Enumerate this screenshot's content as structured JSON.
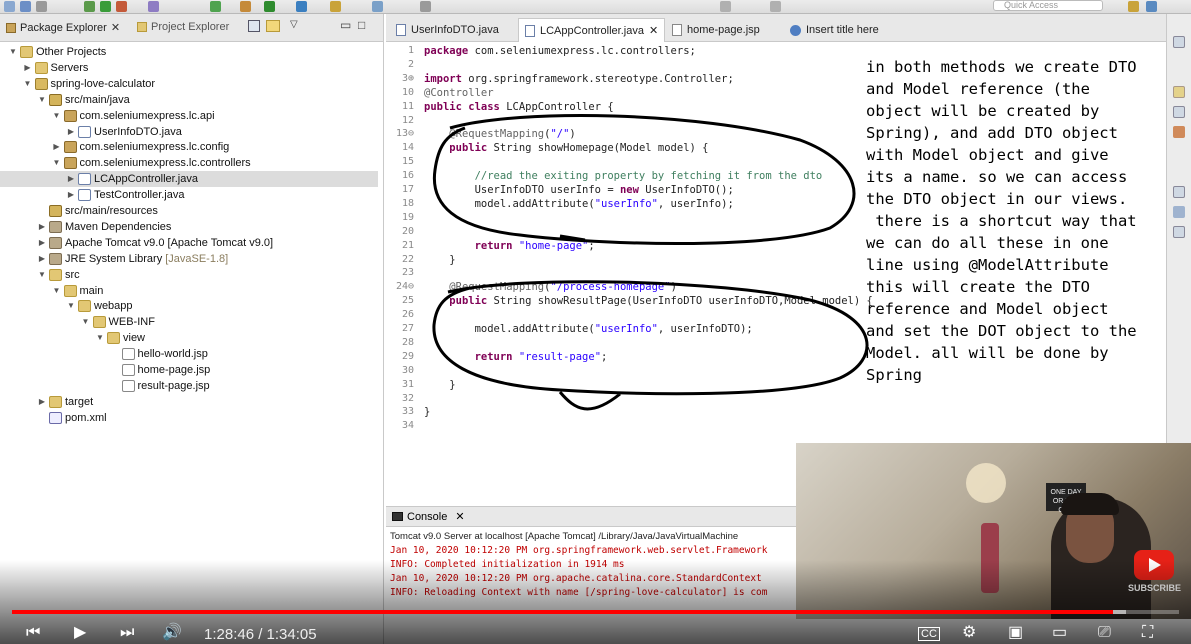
{
  "toolbar": {
    "quick_access_placeholder": "Quick Access"
  },
  "left_panel": {
    "tabs": [
      {
        "label": "Package Explorer"
      },
      {
        "label": "Project Explorer"
      }
    ],
    "tree": [
      {
        "label": "Other Projects",
        "depth": 0,
        "icon": "folder-icon",
        "expanded": true
      },
      {
        "label": "Servers",
        "depth": 1,
        "icon": "folder-icon",
        "expanded": false
      },
      {
        "label": "spring-love-calculator",
        "depth": 1,
        "icon": "project-icon",
        "expanded": true
      },
      {
        "label": "src/main/java",
        "depth": 2,
        "icon": "source-folder-icon",
        "expanded": true
      },
      {
        "label": "com.seleniumexpress.lc.api",
        "depth": 3,
        "icon": "package-icon",
        "expanded": true
      },
      {
        "label": "UserInfoDTO.java",
        "depth": 4,
        "icon": "java-file-icon",
        "expanded": false
      },
      {
        "label": "com.seleniumexpress.lc.config",
        "depth": 3,
        "icon": "package-icon",
        "expanded": false
      },
      {
        "label": "com.seleniumexpress.lc.controllers",
        "depth": 3,
        "icon": "package-icon",
        "expanded": true
      },
      {
        "label": "LCAppController.java",
        "depth": 4,
        "icon": "java-file-icon",
        "expanded": false,
        "selected": true
      },
      {
        "label": "TestController.java",
        "depth": 4,
        "icon": "java-file-icon",
        "expanded": false
      },
      {
        "label": "src/main/resources",
        "depth": 2,
        "icon": "source-folder-icon",
        "leaf": true
      },
      {
        "label": "Maven Dependencies",
        "depth": 2,
        "icon": "library-icon",
        "expanded": false
      },
      {
        "label": "Apache Tomcat v9.0 [Apache Tomcat v9.0]",
        "depth": 2,
        "icon": "library-icon",
        "expanded": false
      },
      {
        "label": "JRE System Library",
        "annotation": "[JavaSE-1.8]",
        "depth": 2,
        "icon": "library-icon",
        "expanded": false
      },
      {
        "label": "src",
        "depth": 2,
        "icon": "folder-icon",
        "expanded": true
      },
      {
        "label": "main",
        "depth": 3,
        "icon": "folder-icon",
        "expanded": true
      },
      {
        "label": "webapp",
        "depth": 4,
        "icon": "folder-icon",
        "expanded": true
      },
      {
        "label": "WEB-INF",
        "depth": 5,
        "icon": "folder-icon",
        "expanded": true
      },
      {
        "label": "view",
        "depth": 6,
        "icon": "folder-icon",
        "expanded": true
      },
      {
        "label": "hello-world.jsp",
        "depth": 7,
        "icon": "jsp-file-icon",
        "leaf": true
      },
      {
        "label": "home-page.jsp",
        "depth": 7,
        "icon": "jsp-file-icon",
        "leaf": true
      },
      {
        "label": "result-page.jsp",
        "depth": 7,
        "icon": "jsp-file-icon",
        "leaf": true
      },
      {
        "label": "target",
        "depth": 2,
        "icon": "folder-icon",
        "expanded": false
      },
      {
        "label": "pom.xml",
        "depth": 2,
        "icon": "xml-file-icon",
        "leaf": true
      }
    ]
  },
  "editor": {
    "tabs": [
      {
        "label": "UserInfoDTO.java",
        "active": false,
        "icon": "java-file-icon"
      },
      {
        "label": "LCAppController.java",
        "active": true,
        "icon": "java-file-icon"
      },
      {
        "label": "home-page.jsp",
        "active": false,
        "icon": "jsp-file-icon"
      },
      {
        "label": "Insert title here",
        "active": false,
        "icon": "web-browser-icon"
      }
    ],
    "line_numbers": [
      "1",
      "2",
      "3⊕",
      "10",
      "11",
      "12",
      "13⊖",
      "14",
      "15",
      "16",
      "17",
      "18",
      "19",
      "20",
      "21",
      "22",
      "23",
      "24⊖",
      "25",
      "26",
      "27",
      "28",
      "29",
      "30",
      "31",
      "32",
      "33",
      "34"
    ],
    "code_lines": [
      "package com.seleniumexpress.lc.controllers;",
      "",
      "import org.springframework.stereotype.Controller;",
      "@Controller",
      "public class LCAppController {",
      "",
      "    @RequestMapping(\"/\")",
      "    public String showHomepage(Model model) {",
      "",
      "        //read the exiting property by fetching it from the dto",
      "        UserInfoDTO userInfo = new UserInfoDTO();",
      "        model.addAttribute(\"userInfo\", userInfo);",
      "",
      "",
      "        return \"home-page\";",
      "    }",
      "",
      "    @RequestMapping(\"/process-homepage\")",
      "    public String showResultPage(UserInfoDTO userInfoDTO,Model model) {",
      "",
      "        model.addAttribute(\"userInfo\", userInfoDTO);",
      "",
      "        return \"result-page\";",
      "",
      "    }",
      "",
      "}",
      ""
    ]
  },
  "annotation_text": "in both methods we create DTO\nand Model reference (the\nobject will be created by\nSpring), and add DTO object\nwith Model object and give\nits a name. so we can access\nthe DTO object in our views.\n there is a shortcut way that\nwe can do all these in one\nline using @ModelAttribute\nthis will create the DTO\nreference and Model object\nand set the DOT object to the\nModel. all will be done by\nSpring",
  "console": {
    "tab_label": "Console",
    "header": "Tomcat v9.0 Server at localhost [Apache Tomcat] /Library/Java/JavaVirtualMachine",
    "lines": [
      "Jan 10, 2020 10:12:20 PM org.springframework.web.servlet.Framework",
      "INFO: Completed initialization in 1914 ms",
      "Jan 10, 2020 10:12:20 PM org.apache.catalina.core.StandardContext",
      "INFO: Reloading Context with name [/spring-love-calculator] is com"
    ]
  },
  "webcam": {
    "wall_sign_text": "ONE DAY OR DAY ONE",
    "subscribe_label": "SUBSCRIBE"
  },
  "player": {
    "current_time": "1:28:46",
    "duration": "1:34:05",
    "played_fraction": 0.9435,
    "loaded_fraction": 0.955,
    "time_display": "1:28:46 / 1:34:05"
  },
  "colors": {
    "progress_played": "#ff0000",
    "subscribe_red": "#e62117",
    "keyword": "#7f0055",
    "string": "#2a00ff",
    "comment": "#3f7f5f"
  }
}
